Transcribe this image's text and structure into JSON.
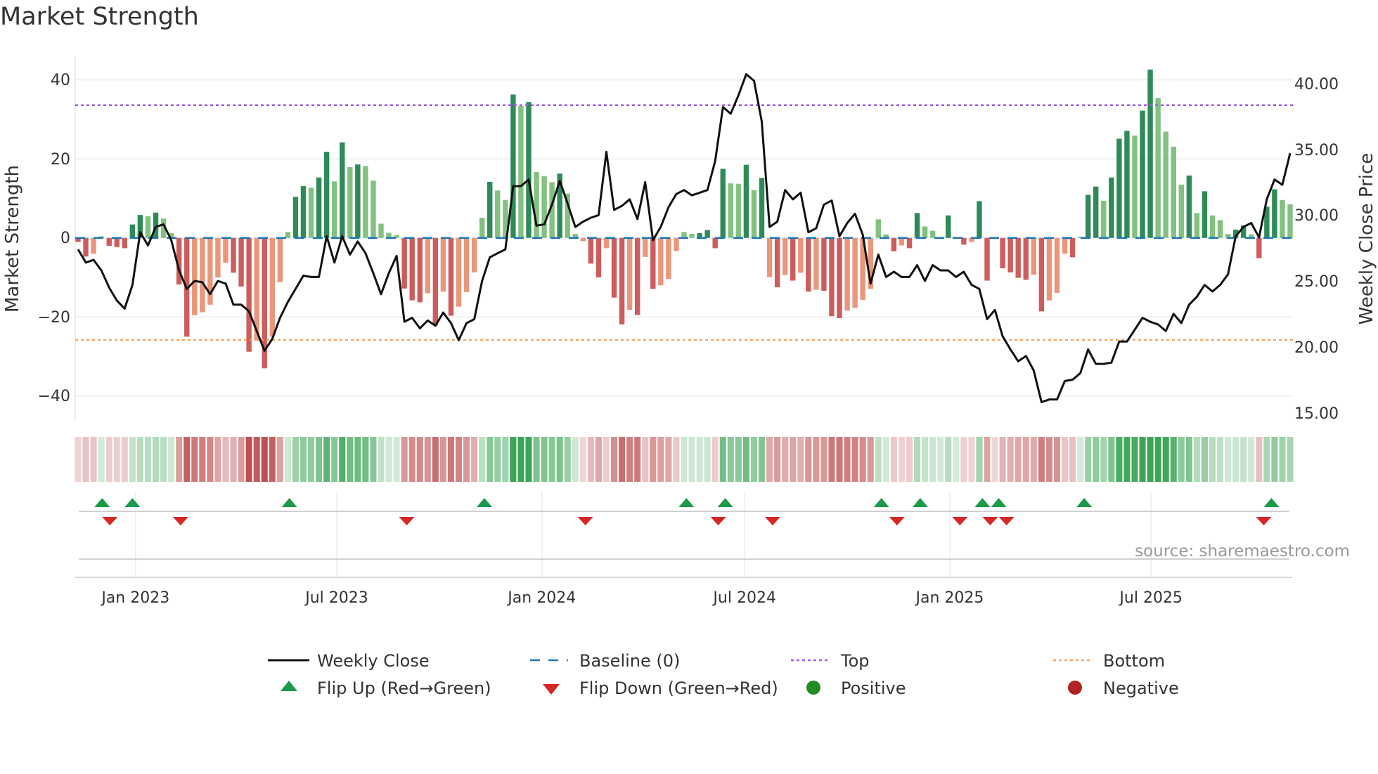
{
  "title": "Market Strength",
  "source": "source: sharemaestro.com",
  "colors": {
    "bar_pos_strong": "#2e8b57",
    "bar_pos_weak": "#82c17f",
    "bar_neg_strong": "#cd5c5c",
    "bar_neg_weak": "#e9967a",
    "close": "#111111",
    "baseline": "#1f77b4",
    "top": "#9b5de5",
    "bottom": "#f4a460",
    "flip_up": "#1a9a4a",
    "flip_down": "#d62728",
    "positive": "#228b22",
    "negative": "#b22222"
  },
  "chart_data": {
    "type": "bar+line",
    "title": "Market Strength",
    "ylabel": "Market Strength",
    "y2label": "Weekly Close Price",
    "ylim": [
      -45,
      46
    ],
    "y2lim": [
      14.2,
      42.3
    ],
    "left_ticks": [
      "40",
      "20",
      "0",
      "−20",
      "−40"
    ],
    "left_tick_values": [
      40,
      20,
      0,
      -20,
      -40
    ],
    "right_ticks": [
      "40.00",
      "35.00",
      "30.00",
      "25.00",
      "20.00",
      "15.00"
    ],
    "right_tick_values": [
      40,
      35,
      30,
      25,
      20,
      15
    ],
    "x_ticks": [
      {
        "label": "Jan 2023",
        "week": 7.4
      },
      {
        "label": "Jul 2023",
        "week": 33.3
      },
      {
        "label": "Jan 2024",
        "week": 59.7
      },
      {
        "label": "Jul 2024",
        "week": 85.8
      },
      {
        "label": "Jan 2025",
        "week": 112.2
      },
      {
        "label": "Jul 2025",
        "week": 138.1
      }
    ],
    "top_level": 33.6,
    "bottom_level": -25.8,
    "baseline": 0,
    "strength": [
      -1,
      -4.7,
      -4,
      0.4,
      -2,
      -2.3,
      -2.6,
      3.4,
      5.8,
      5.5,
      6.4,
      4.9,
      1.2,
      -11.8,
      -25,
      -19.6,
      -18.8,
      -16.9,
      -10,
      -6.3,
      -8.8,
      -12.3,
      -28.8,
      -26,
      -33,
      -25,
      -11.2,
      1.5,
      10.4,
      13.1,
      12.7,
      15.3,
      21.8,
      14.3,
      24.2,
      17.9,
      18.6,
      18.2,
      14.5,
      3.6,
      1.3,
      0.7,
      -12.8,
      -15.8,
      -16.3,
      -14,
      -22,
      -13.6,
      -19.7,
      -17.4,
      -13.7,
      -8.7,
      5.1,
      14.2,
      12,
      9.6,
      36.3,
      33.4,
      34.4,
      16.7,
      15.6,
      14.1,
      16.3,
      11.2,
      1,
      -0.8,
      -6.5,
      -10,
      -2.6,
      -15.1,
      -21.9,
      -18.2,
      -19.5,
      -4.8,
      -12.9,
      -12,
      -10.4,
      -3.3,
      1.5,
      1,
      1.2,
      2,
      -2.6,
      17.5,
      13.8,
      13.7,
      18.5,
      12.1,
      15.2,
      -9.9,
      -12.5,
      -9.4,
      -10.8,
      -8.8,
      -13.6,
      -13.1,
      -13.4,
      -19.8,
      -20.3,
      -18.4,
      -17.7,
      -15.7,
      -12.9,
      4.7,
      0.9,
      -3.4,
      -1.9,
      -2.6,
      6.3,
      2.9,
      1.8,
      0.2,
      5.7,
      0.2,
      -1.7,
      -1,
      9.3,
      -10.8,
      -0.3,
      -7.7,
      -8.7,
      -10.1,
      -10.6,
      -9.3,
      -18.6,
      -15.8,
      -13.9,
      -4,
      -4.9,
      0.3,
      10.9,
      13,
      9.4,
      15.3,
      25.1,
      27.1,
      25.9,
      32.2,
      42.6,
      35.4,
      26.9,
      23.1,
      13.5,
      15.8,
      6.3,
      11.8,
      5.7,
      4.5,
      1,
      2.1,
      3.2,
      0.9,
      -5.1,
      7.9,
      12.3,
      9.6,
      8.5
    ],
    "weekly_close": [
      27.4,
      26.4,
      26.6,
      25.8,
      24.5,
      23.5,
      22.9,
      24.7,
      28.7,
      27.7,
      29.1,
      29.3,
      28.1,
      25.8,
      24.4,
      25,
      24.9,
      24,
      25,
      24.8,
      23.2,
      23.2,
      22.7,
      21.2,
      19.7,
      20.6,
      22.2,
      23.4,
      24.4,
      25.4,
      25.3,
      25.3,
      28.4,
      26.4,
      28.4,
      27,
      28,
      27.1,
      25.6,
      24,
      25.6,
      26.9,
      21.9,
      22.2,
      21.4,
      22,
      21.6,
      22.6,
      21.8,
      20.5,
      21.8,
      22.1,
      25,
      26.8,
      27.1,
      27.4,
      32.2,
      32.2,
      32.7,
      29.2,
      29.3,
      30.8,
      32.6,
      30.9,
      29.1,
      29.5,
      29.8,
      30,
      34.8,
      30.4,
      30.7,
      31.2,
      29.7,
      32.5,
      28.1,
      29.1,
      30.6,
      31.6,
      31.9,
      31.5,
      31.7,
      31.9,
      34.1,
      38.2,
      37.7,
      39.1,
      40.7,
      40.2,
      37.1,
      29.1,
      29.5,
      31.9,
      31.2,
      31.7,
      28.7,
      29,
      30.8,
      31.1,
      28.4,
      29.4,
      30.1,
      28.5,
      24.8,
      27,
      25.3,
      25.7,
      25.3,
      25.3,
      26.2,
      25,
      26.2,
      25.8,
      25.8,
      25.3,
      25.7,
      24.7,
      24.4,
      22.1,
      22.8,
      20.8,
      19.8,
      18.9,
      19.3,
      18.2,
      15.8,
      16,
      16,
      17.4,
      17.5,
      18,
      19.8,
      18.7,
      18.7,
      18.8,
      20.4,
      20.4,
      21.3,
      22.2,
      21.9,
      21.7,
      21.2,
      22.5,
      21.8,
      23.2,
      23.8,
      24.7,
      24.2,
      24.7,
      25.5,
      28.4,
      29.1,
      29.4,
      28.3,
      31.2,
      32.7,
      32.3,
      34.7
    ],
    "flip_up_weeks": [
      3.1,
      7,
      27.2,
      52.3,
      78.3,
      83.3,
      103.4,
      108.4,
      116.4,
      118.5,
      129.5,
      153.6
    ],
    "flip_down_weeks": [
      4.1,
      13.2,
      42.3,
      65.3,
      82.4,
      89.4,
      105.4,
      113.5,
      117.4,
      119.5,
      152.6
    ],
    "legend": [
      {
        "label": "Weekly Close",
        "kind": "line"
      },
      {
        "label": "Baseline (0)",
        "kind": "dashed"
      },
      {
        "label": "Top",
        "kind": "dotted-top"
      },
      {
        "label": "Bottom",
        "kind": "dotted-bottom"
      },
      {
        "label": "Flip Up (Red→Green)",
        "kind": "triangle-up"
      },
      {
        "label": "Flip Down (Green→Red)",
        "kind": "triangle-down"
      },
      {
        "label": "Positive",
        "kind": "dot-positive"
      },
      {
        "label": "Negative",
        "kind": "dot-negative"
      }
    ],
    "legend_position": "bottom"
  }
}
